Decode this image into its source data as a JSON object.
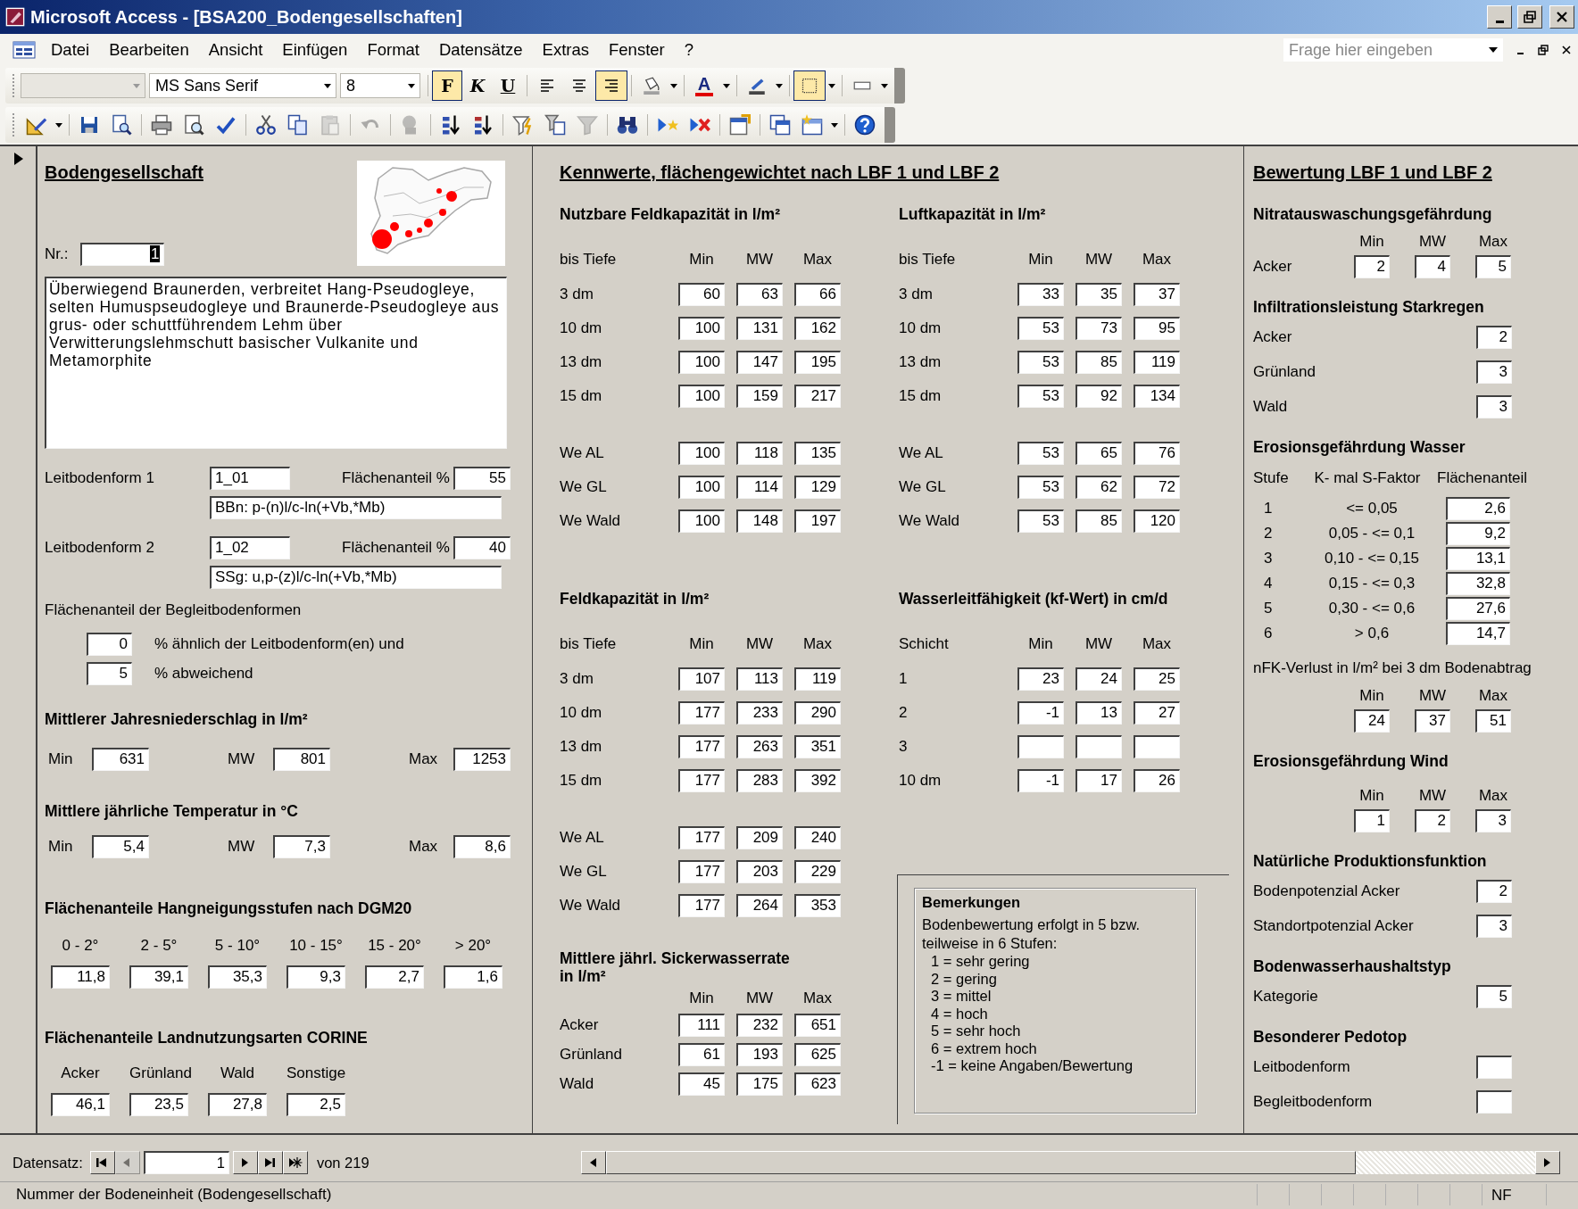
{
  "window": {
    "title": "Microsoft Access - [BSA200_Bodengesellschaften]"
  },
  "menu": [
    "Datei",
    "Bearbeiten",
    "Ansicht",
    "Einfügen",
    "Format",
    "Datensätze",
    "Extras",
    "Fenster",
    "?"
  ],
  "help": {
    "placeholder": "Frage hier eingeben"
  },
  "format_toolbar": {
    "font": "MS Sans Serif",
    "size": "8",
    "styles": [
      {
        "label": "F",
        "selected": true
      },
      {
        "label": "K",
        "selected": false
      },
      {
        "label": "U",
        "selected": false
      }
    ],
    "align": [
      {
        "kind": "left",
        "selected": false
      },
      {
        "kind": "center",
        "selected": false
      },
      {
        "kind": "right",
        "selected": true
      }
    ],
    "color_tools": [
      {
        "kind": "fill",
        "selected": false
      },
      {
        "kind": "font",
        "label": "A",
        "selected": false
      },
      {
        "kind": "line",
        "selected": false
      },
      {
        "kind": "border",
        "selected": true
      },
      {
        "kind": "effect",
        "selected": false
      }
    ]
  },
  "toolbar": [
    {
      "kind": "design",
      "disabled": false
    },
    {
      "kind": "save",
      "disabled": false
    },
    {
      "kind": "search",
      "disabled": false
    },
    {
      "kind": "print",
      "disabled": false
    },
    {
      "kind": "preview",
      "disabled": false
    },
    {
      "kind": "spell",
      "disabled": false
    },
    {
      "kind": "cut",
      "disabled": false
    },
    {
      "kind": "copy",
      "disabled": false
    },
    {
      "kind": "paste",
      "disabled": true
    },
    {
      "kind": "undo",
      "disabled": true
    },
    {
      "kind": "links",
      "disabled": true
    },
    {
      "kind": "sortasc",
      "disabled": false
    },
    {
      "kind": "sortdesc",
      "disabled": false
    },
    {
      "kind": "filtersel",
      "disabled": false
    },
    {
      "kind": "filterform",
      "disabled": false
    },
    {
      "kind": "filter",
      "disabled": true
    },
    {
      "kind": "find",
      "disabled": false
    },
    {
      "kind": "newrec",
      "disabled": false
    },
    {
      "kind": "delrec",
      "disabled": false
    },
    {
      "kind": "props",
      "disabled": false
    },
    {
      "kind": "dbwin",
      "disabled": false
    },
    {
      "kind": "newobj",
      "disabled": false
    },
    {
      "kind": "help",
      "disabled": false
    }
  ],
  "form": {
    "left": {
      "title": "Bodengesellschaft",
      "nr": {
        "label": "Nr.:",
        "value": "1",
        "focused": true
      },
      "description": "Überwiegend Braunerden, verbreitet Hang-Pseudogleye, selten Humuspseudogleye und Braunerde-Pseudogleye aus grus- oder schuttführendem Lehm über Verwitterungslehmschutt basischer Vulkanite und Metamorphite",
      "leitbodenformen": [
        {
          "label": "Leitbodenform 1",
          "code": "1_01",
          "share_label": "Flächenanteil %",
          "share": "55",
          "formula": "BBn: p-(n)l/c-ln(+Vb,*Mb)"
        },
        {
          "label": "Leitbodenform 2",
          "code": "1_02",
          "share_label": "Flächenanteil %",
          "share": "40",
          "formula": "SSg: u,p-(z)l/c-ln(+Vb,*Mb)"
        }
      ],
      "begleit": {
        "title": "Flächenanteil der Begleitbodenformen",
        "rows": [
          {
            "value": "0",
            "text": "%  ähnlich der Leitbodenform(en) und"
          },
          {
            "value": "5",
            "text": "%  abweichend"
          }
        ]
      },
      "triples": [
        {
          "title": "Mittlerer Jahresniederschlag in l/m²",
          "items": [
            {
              "label": "Min",
              "value": "631"
            },
            {
              "label": "MW",
              "value": "801"
            },
            {
              "label": "Max",
              "value": "1253"
            }
          ]
        },
        {
          "title": "Mittlere jährliche Temperatur in °C",
          "items": [
            {
              "label": "Min",
              "value": "5,4"
            },
            {
              "label": "MW",
              "value": "7,3"
            },
            {
              "label": "Max",
              "value": "8,6"
            }
          ]
        }
      ],
      "hangneigung": {
        "title": "Flächenanteile Hangneigungsstufen nach  DGM20",
        "columns": [
          {
            "label": "0 - 2°",
            "value": "11,8"
          },
          {
            "label": "2 - 5°",
            "value": "39,1"
          },
          {
            "label": "5 - 10°",
            "value": "35,3"
          },
          {
            "label": "10 - 15°",
            "value": "9,3"
          },
          {
            "label": "15 - 20°",
            "value": "2,7"
          },
          {
            "label": "> 20°",
            "value": "1,6"
          }
        ]
      },
      "corine": {
        "title": "Flächenanteile Landnutzungsarten CORINE",
        "columns": [
          {
            "label": "Acker",
            "value": "46,1"
          },
          {
            "label": "Grünland",
            "value": "23,5"
          },
          {
            "label": "Wald",
            "value": "27,8"
          },
          {
            "label": "Sonstige",
            "value": "2,5"
          }
        ]
      }
    },
    "middle": {
      "title": "Kennwerte, flächengewichtet nach LBF 1 und LBF 2",
      "left_groups": [
        {
          "title": "Nutzbare Feldkapazität in l/m²",
          "row_header": "bis Tiefe",
          "columns": [
            "Min",
            "MW",
            "Max"
          ],
          "row_groups": [
            [
              {
                "label": "3 dm",
                "values": [
                  "60",
                  "63",
                  "66"
                ]
              },
              {
                "label": "10 dm",
                "values": [
                  "100",
                  "131",
                  "162"
                ]
              },
              {
                "label": "13 dm",
                "values": [
                  "100",
                  "147",
                  "195"
                ]
              },
              {
                "label": "15 dm",
                "values": [
                  "100",
                  "159",
                  "217"
                ]
              }
            ],
            [
              {
                "label": "We AL",
                "values": [
                  "100",
                  "118",
                  "135"
                ]
              },
              {
                "label": "We GL",
                "values": [
                  "100",
                  "114",
                  "129"
                ]
              },
              {
                "label": "We Wald",
                "values": [
                  "100",
                  "148",
                  "197"
                ]
              }
            ]
          ]
        },
        {
          "title": "Feldkapazität in l/m²",
          "row_header": "bis Tiefe",
          "columns": [
            "Min",
            "MW",
            "Max"
          ],
          "row_groups": [
            [
              {
                "label": "3 dm",
                "values": [
                  "107",
                  "113",
                  "119"
                ]
              },
              {
                "label": "10 dm",
                "values": [
                  "177",
                  "233",
                  "290"
                ]
              },
              {
                "label": "13 dm",
                "values": [
                  "177",
                  "263",
                  "351"
                ]
              },
              {
                "label": "15 dm",
                "values": [
                  "177",
                  "283",
                  "392"
                ]
              }
            ],
            [
              {
                "label": "We AL",
                "values": [
                  "177",
                  "209",
                  "240"
                ]
              },
              {
                "label": "We GL",
                "values": [
                  "177",
                  "203",
                  "229"
                ]
              },
              {
                "label": "We Wald",
                "values": [
                  "177",
                  "264",
                  "353"
                ]
              }
            ]
          ]
        },
        {
          "title_lines": [
            "Mittlere jährl. Sickerwasserrate",
            "in  l/m²"
          ],
          "columns": [
            "Min",
            "MW",
            "Max"
          ],
          "row_groups": [
            [
              {
                "label": "Acker",
                "values": [
                  "111",
                  "232",
                  "651"
                ]
              },
              {
                "label": "Grünland",
                "values": [
                  "61",
                  "193",
                  "625"
                ]
              },
              {
                "label": "Wald",
                "values": [
                  "45",
                  "175",
                  "623"
                ]
              }
            ]
          ]
        }
      ],
      "right_groups": [
        {
          "title": "Luftkapazität in l/m²",
          "row_header": "bis Tiefe",
          "columns": [
            "Min",
            "MW",
            "Max"
          ],
          "row_groups": [
            [
              {
                "label": "3 dm",
                "values": [
                  "33",
                  "35",
                  "37"
                ]
              },
              {
                "label": "10 dm",
                "values": [
                  "53",
                  "73",
                  "95"
                ]
              },
              {
                "label": "13 dm",
                "values": [
                  "53",
                  "85",
                  "119"
                ]
              },
              {
                "label": "15 dm",
                "values": [
                  "53",
                  "92",
                  "134"
                ]
              }
            ],
            [
              {
                "label": "We AL",
                "values": [
                  "53",
                  "65",
                  "76"
                ]
              },
              {
                "label": "We GL",
                "values": [
                  "53",
                  "62",
                  "72"
                ]
              },
              {
                "label": "We Wald",
                "values": [
                  "53",
                  "85",
                  "120"
                ]
              }
            ]
          ]
        },
        {
          "title": "Wasserleitfähigkeit (kf-Wert) in cm/d",
          "row_header": "Schicht",
          "columns": [
            "Min",
            "MW",
            "Max"
          ],
          "row_groups": [
            [
              {
                "label": "1",
                "values": [
                  "23",
                  "24",
                  "25"
                ]
              },
              {
                "label": "2",
                "values": [
                  "-1",
                  "13",
                  "27"
                ]
              },
              {
                "label": "3"
              },
              {
                "label": "10 dm",
                "values": [
                  "-1",
                  "17",
                  "26"
                ]
              }
            ]
          ]
        }
      ],
      "remarks": {
        "title": "Bemerkungen",
        "text": "Bodenbewertung erfolgt in 5 bzw. teilweise in 6 Stufen:",
        "scale": [
          "1 = sehr gering",
          "2 = gering",
          "3 = mittel",
          "4 = hoch",
          "5 = sehr hoch",
          "6 = extrem hoch",
          "-1 = keine Angaben/Bewertung"
        ]
      }
    },
    "right": {
      "title": "Bewertung LBF 1 und LBF 2",
      "sections": [
        {
          "kind": "triple",
          "title": "Nitratauswaschungsgefährdung",
          "headers": [
            "Min",
            "MW",
            "Max"
          ],
          "rows": [
            {
              "label": "Acker",
              "values": [
                "2",
                "4",
                "5"
              ]
            }
          ]
        },
        {
          "kind": "list",
          "title": "Infiltrationsleistung Starkregen",
          "items": [
            {
              "label": "Acker",
              "value": "2"
            },
            {
              "label": "Grünland",
              "value": "3"
            },
            {
              "label": "Wald",
              "value": "3"
            }
          ]
        },
        {
          "kind": "erosion",
          "title": "Erosionsgefährdung Wasser",
          "headers": [
            "Stufe",
            "K- mal S-Faktor",
            "Flächenanteil"
          ],
          "rows": [
            {
              "stufe": "1",
              "range": "<= 0,05",
              "value": "2,6"
            },
            {
              "stufe": "2",
              "range": "0,05 - <= 0,1",
              "value": "9,2"
            },
            {
              "stufe": "3",
              "range": "0,10 - <= 0,15",
              "value": "13,1"
            },
            {
              "stufe": "4",
              "range": "0,15 - <= 0,3",
              "value": "32,8"
            },
            {
              "stufe": "5",
              "range": "0,30 - <= 0,6",
              "value": "27,6"
            },
            {
              "stufe": "6",
              "range": "> 0,6",
              "value": "14,7"
            }
          ]
        },
        {
          "kind": "triple",
          "subtitle": "nFK-Verlust in l/m² bei 3 dm Bodenabtrag",
          "headers": [
            "Min",
            "MW",
            "Max"
          ],
          "rows": [
            {
              "values": [
                "24",
                "37",
                "51"
              ]
            }
          ]
        },
        {
          "kind": "triple",
          "title": "Erosionsgefährdung Wind",
          "headers": [
            "Min",
            "MW",
            "Max"
          ],
          "rows": [
            {
              "values": [
                "1",
                "2",
                "3"
              ]
            }
          ]
        },
        {
          "kind": "list",
          "title": "Natürliche Produktionsfunktion",
          "items": [
            {
              "label": "Bodenpotenzial Acker",
              "value": "2"
            },
            {
              "label": "Standortpotenzial Acker",
              "value": "3"
            }
          ]
        },
        {
          "kind": "list",
          "title": "Bodenwasserhaushaltstyp",
          "items": [
            {
              "label": "Kategorie",
              "value": "5"
            }
          ]
        },
        {
          "kind": "list",
          "title": "Besonderer Pedotop",
          "items": [
            {
              "label": "Leitbodenform"
            },
            {
              "label": "Begleitbodenform"
            }
          ]
        }
      ]
    }
  },
  "navigation": {
    "label": "Datensatz:",
    "record": "1",
    "total": "von 219",
    "buttons": [
      {
        "kind": "first",
        "disabled": false
      },
      {
        "kind": "prev",
        "disabled": true
      },
      {
        "kind": "next",
        "disabled": false
      },
      {
        "kind": "last",
        "disabled": false
      },
      {
        "kind": "new",
        "disabled": false
      }
    ]
  },
  "status_bar": {
    "text": "Nummer der Bodeneinheit (Bodengesellschaft)",
    "mode": "NF"
  }
}
